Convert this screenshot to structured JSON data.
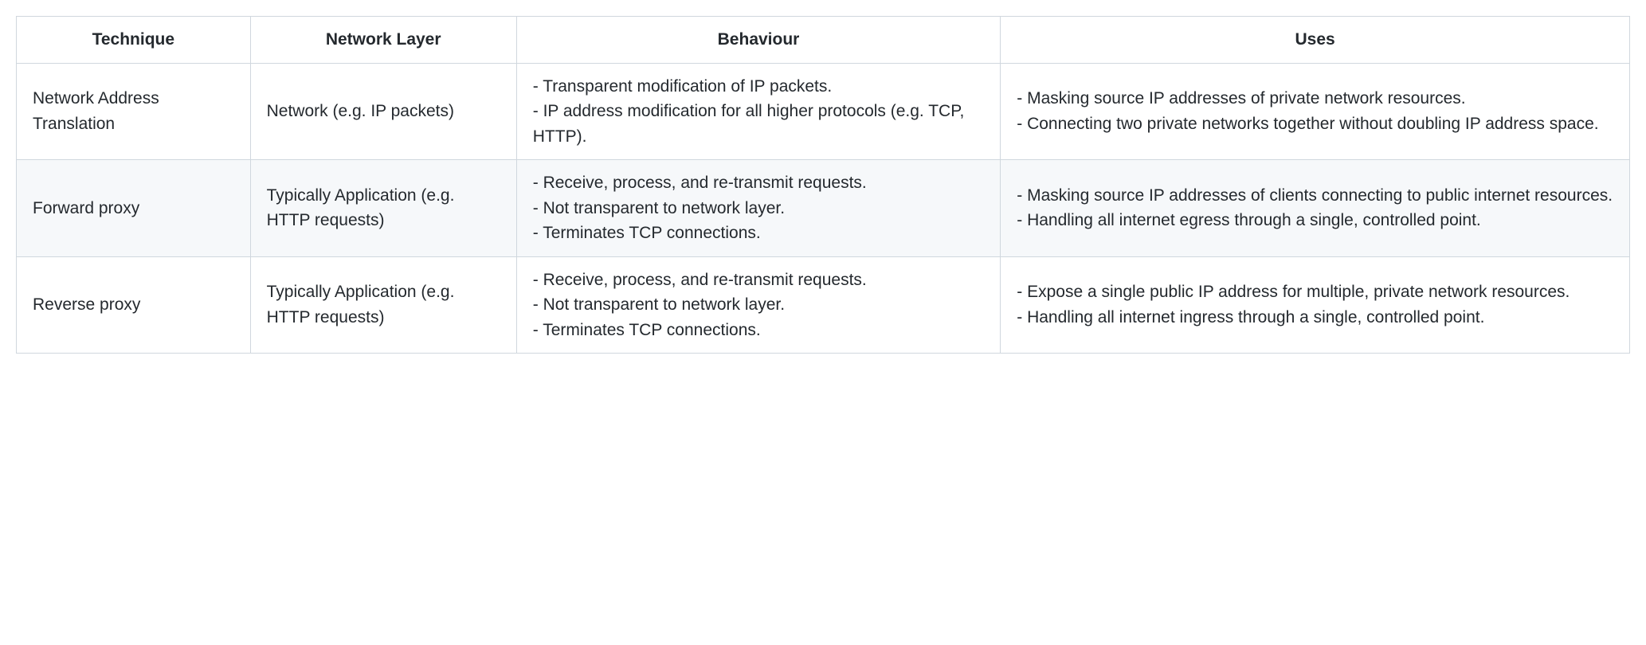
{
  "table": {
    "headers": {
      "technique": "Technique",
      "layer": "Network Layer",
      "behaviour": "Behaviour",
      "uses": "Uses"
    },
    "rows": [
      {
        "technique": "Network Address Translation",
        "layer": "Network (e.g. IP packets)",
        "behaviour": "- Transparent modification of IP packets.\n- IP address modification for all higher protocols (e.g. TCP, HTTP).",
        "uses": "- Masking source IP addresses of private network resources.\n- Connecting two private networks together without doubling IP address space."
      },
      {
        "technique": "Forward proxy",
        "layer": "Typically Application (e.g. HTTP requests)",
        "behaviour": "- Receive, process, and re-transmit requests.\n- Not transparent to network layer.\n- Terminates TCP connections.",
        "uses": "- Masking source IP addresses of clients connecting to public internet resources.\n- Handling all internet egress through a single, controlled point."
      },
      {
        "technique": "Reverse proxy",
        "layer": "Typically Application (e.g. HTTP requests)",
        "behaviour": "- Receive, process, and re-transmit requests.\n- Not transparent to network layer.\n- Terminates TCP connections.",
        "uses": "- Expose a single public IP address for multiple, private network resources.\n- Handling all internet ingress through a single, controlled point."
      }
    ]
  }
}
